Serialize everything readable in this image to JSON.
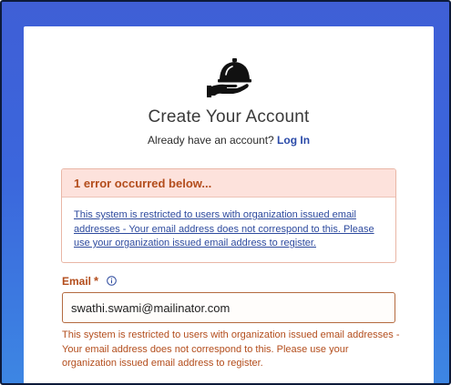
{
  "page": {
    "title": "Create Your Account",
    "account_prompt": "Already have an account?",
    "login_link": "Log In"
  },
  "alert": {
    "heading": "1 error occurred below...",
    "message": "This system is restricted to users with organization issued email addresses - Your email address does not correspond to this. Please use your organization issued email address to register."
  },
  "email_field": {
    "label": "Email",
    "required_marker": "*",
    "value": "swathi.swami@mailinator.com",
    "error": "This system is restricted to users with organization issued email addresses - Your email address does not correspond to this. Please use your organization issued email address to register."
  },
  "icons": {
    "logo": "serving-cloche-icon",
    "info": "info-icon"
  },
  "colors": {
    "background_gradient_top": "#3f5fd6",
    "background_gradient_bottom": "#3d86e3",
    "error_text": "#b34d1c",
    "alert_header_bg": "#fde2dc",
    "link": "#2a4aa8"
  }
}
